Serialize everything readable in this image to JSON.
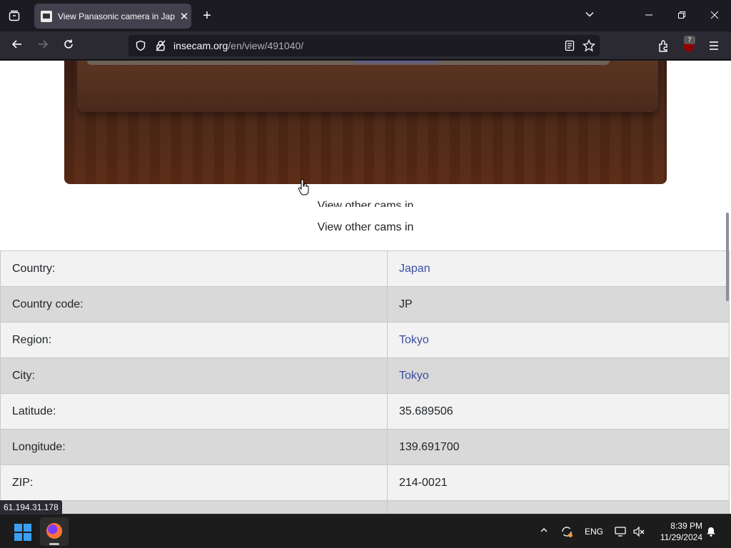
{
  "browser": {
    "tab_title": "View Panasonic camera in Japan",
    "url_domain": "insecam.org",
    "url_path": "/en/view/491040/",
    "extension_badge": "7"
  },
  "page": {
    "link_clipped": "View other cams in",
    "view_other_cams": "View other cams in",
    "info_rows": [
      {
        "label": "Country:",
        "value": "Japan",
        "is_link": true
      },
      {
        "label": "Country code:",
        "value": "JP",
        "is_link": false
      },
      {
        "label": "Region:",
        "value": "Tokyo",
        "is_link": true
      },
      {
        "label": "City:",
        "value": "Tokyo",
        "is_link": true
      },
      {
        "label": "Latitude:",
        "value": "35.689506",
        "is_link": false
      },
      {
        "label": "Longitude:",
        "value": "139.691700",
        "is_link": false
      },
      {
        "label": "ZIP:",
        "value": "214-0021",
        "is_link": false
      }
    ],
    "status_url": "61.194.31.178"
  },
  "taskbar": {
    "language": "ENG",
    "time": "8:39 PM",
    "date": "11/29/2024"
  },
  "colors": {
    "link": "#3a4fa0",
    "row_odd": "#f2f2f2",
    "row_even": "#d9d9d9"
  }
}
